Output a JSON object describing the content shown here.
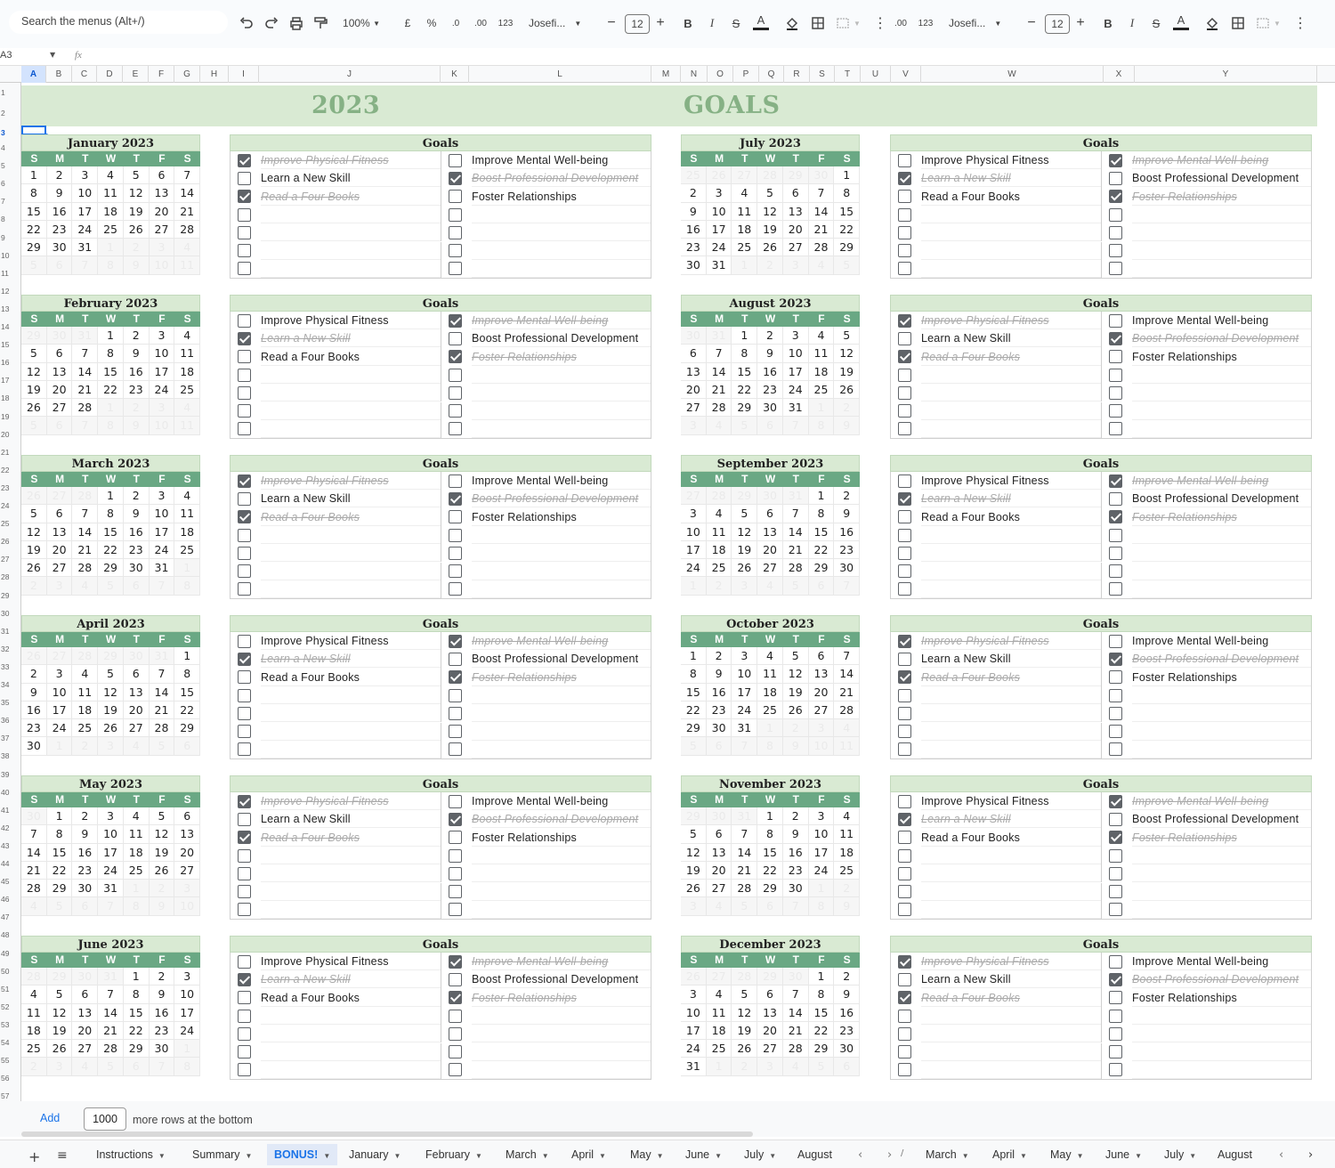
{
  "toolbar": {
    "search_placeholder": "Search the menus (Alt+/)",
    "zoom": "100%",
    "currency": "£",
    "percent": "%",
    "dec_less": ".0",
    "dec_more": ".00",
    "format_123": "123",
    "font1": "Josefi...",
    "font2": "Josefi...",
    "size1": "12",
    "size2": "12",
    "bold": "B",
    "italic": "I",
    "strike": "S",
    "textcolor": "A"
  },
  "formula": {
    "cell_ref": "A3",
    "fx": "fx"
  },
  "columns": [
    "A",
    "B",
    "C",
    "D",
    "E",
    "F",
    "G",
    "H",
    "I",
    "J",
    "K",
    "L",
    "M",
    "N",
    "O",
    "P",
    "Q",
    "R",
    "S",
    "T",
    "U",
    "V",
    "W",
    "X",
    "Y"
  ],
  "banner": {
    "year": "2023",
    "title": "GOALS"
  },
  "weekdays": [
    "S",
    "M",
    "T",
    "W",
    "T",
    "F",
    "S"
  ],
  "goals_header": "Goals",
  "goal_texts": {
    "a": "Improve Physical Fitness",
    "b": "Learn a New Skill",
    "c": "Read a Four Books",
    "d": "Improve Mental Well-being",
    "e": "Boost Professional Development",
    "f": "Foster Relationships"
  },
  "months": [
    {
      "title": "January 2023",
      "start": 0,
      "days": 31,
      "prev": 31,
      "pattern": "A"
    },
    {
      "title": "February 2023",
      "start": 3,
      "days": 28,
      "prev": 31,
      "pattern": "B"
    },
    {
      "title": "March 2023",
      "start": 3,
      "days": 31,
      "prev": 28,
      "pattern": "A"
    },
    {
      "title": "April 2023",
      "start": 6,
      "days": 30,
      "prev": 31,
      "pattern": "B"
    },
    {
      "title": "May 2023",
      "start": 1,
      "days": 31,
      "prev": 30,
      "pattern": "A"
    },
    {
      "title": "June 2023",
      "start": 4,
      "days": 30,
      "prev": 31,
      "pattern": "B"
    },
    {
      "title": "July 2023",
      "start": 6,
      "days": 31,
      "prev": 30,
      "pattern": "C"
    },
    {
      "title": "August 2023",
      "start": 2,
      "days": 31,
      "prev": 31,
      "pattern": "D"
    },
    {
      "title": "September 2023",
      "start": 5,
      "days": 30,
      "prev": 31,
      "pattern": "C"
    },
    {
      "title": "October 2023",
      "start": 0,
      "days": 31,
      "prev": 30,
      "pattern": "D"
    },
    {
      "title": "November 2023",
      "start": 3,
      "days": 30,
      "prev": 31,
      "pattern": "C"
    },
    {
      "title": "December 2023",
      "start": 5,
      "days": 31,
      "prev": 30,
      "pattern": "D"
    }
  ],
  "patterns": {
    "A": [
      true,
      false,
      true,
      false,
      true,
      false
    ],
    "B": [
      false,
      true,
      false,
      true,
      false,
      true
    ],
    "C": [
      false,
      true,
      false,
      true,
      false,
      true
    ],
    "D": [
      true,
      false,
      true,
      false,
      true,
      false
    ]
  },
  "add_rows": {
    "add_label": "Add",
    "count": "1000",
    "suffix": "more rows at the bottom"
  },
  "tabs": [
    {
      "label": "Instructions",
      "active": false
    },
    {
      "label": "Summary",
      "active": false
    },
    {
      "label": "BONUS!",
      "active": true
    },
    {
      "label": "January",
      "active": false
    },
    {
      "label": "February",
      "active": false
    },
    {
      "label": "March",
      "active": false
    },
    {
      "label": "April",
      "active": false
    },
    {
      "label": "May",
      "active": false
    },
    {
      "label": "June",
      "active": false
    },
    {
      "label": "July",
      "active": false
    },
    {
      "label": "August",
      "active": false
    },
    {
      "label": "March",
      "active": false
    },
    {
      "label": "April",
      "active": false
    },
    {
      "label": "May",
      "active": false
    },
    {
      "label": "June",
      "active": false
    },
    {
      "label": "July",
      "active": false
    },
    {
      "label": "August",
      "active": false
    }
  ]
}
